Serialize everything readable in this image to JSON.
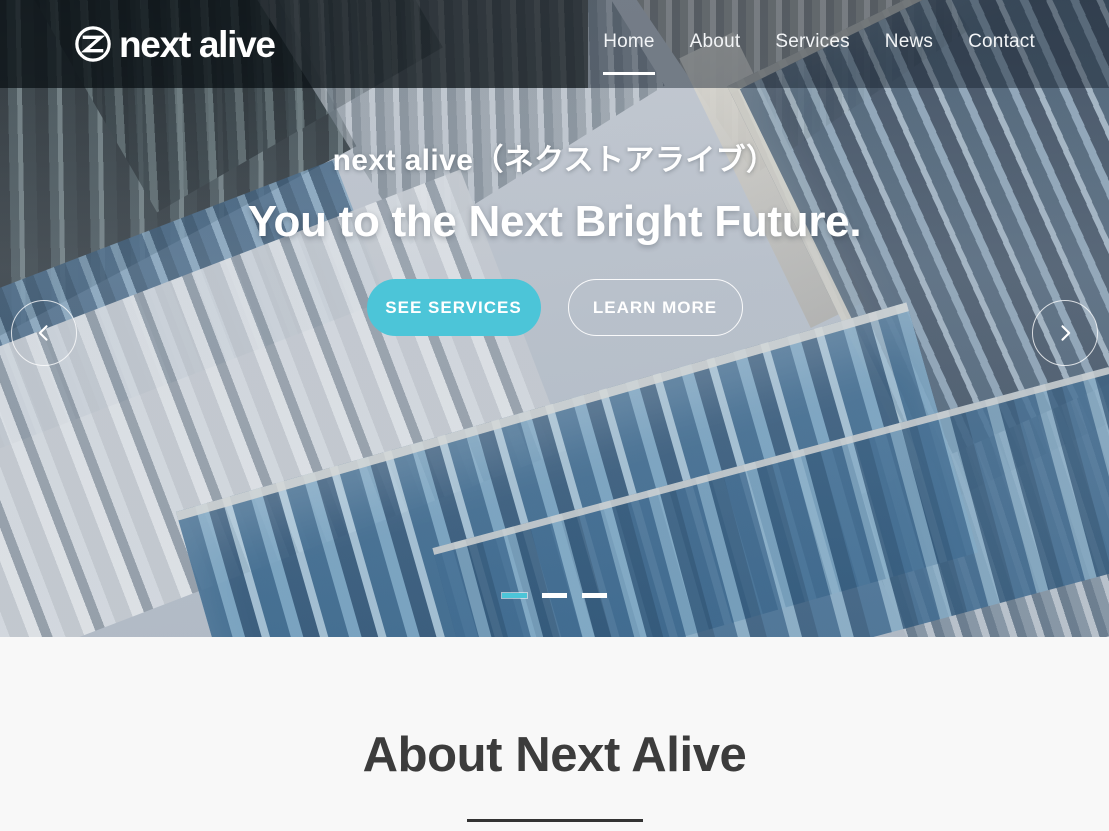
{
  "site": {
    "brand_name": "next alive",
    "logo_icon": "circle-arrow-logo-icon"
  },
  "header": {
    "nav_items": [
      {
        "label": "Home",
        "active": true
      },
      {
        "label": "About",
        "active": false
      },
      {
        "label": "Services",
        "active": false
      },
      {
        "label": "News",
        "active": false
      },
      {
        "label": "Contact",
        "active": false
      }
    ]
  },
  "hero": {
    "subtitle": "next alive（ネクストアライブ）",
    "title": "You to the Next Bright Future.",
    "primary_button": "SEE SERVICES",
    "secondary_button": "LEARN MORE",
    "prev_icon": "chevron-left-icon",
    "next_icon": "chevron-right-icon",
    "slides_total": 3,
    "slide_current": 1
  },
  "about": {
    "heading": "About Next Alive"
  },
  "colors": {
    "accent_teal": "#4cc5d8",
    "hero_text": "#ffffff",
    "about_heading": "#3c3c3c",
    "about_background": "#f8f8f8",
    "header_overlay_left": "rgba(10,16,20,.74)",
    "header_overlay_right": "rgba(24,34,48,.46)"
  }
}
